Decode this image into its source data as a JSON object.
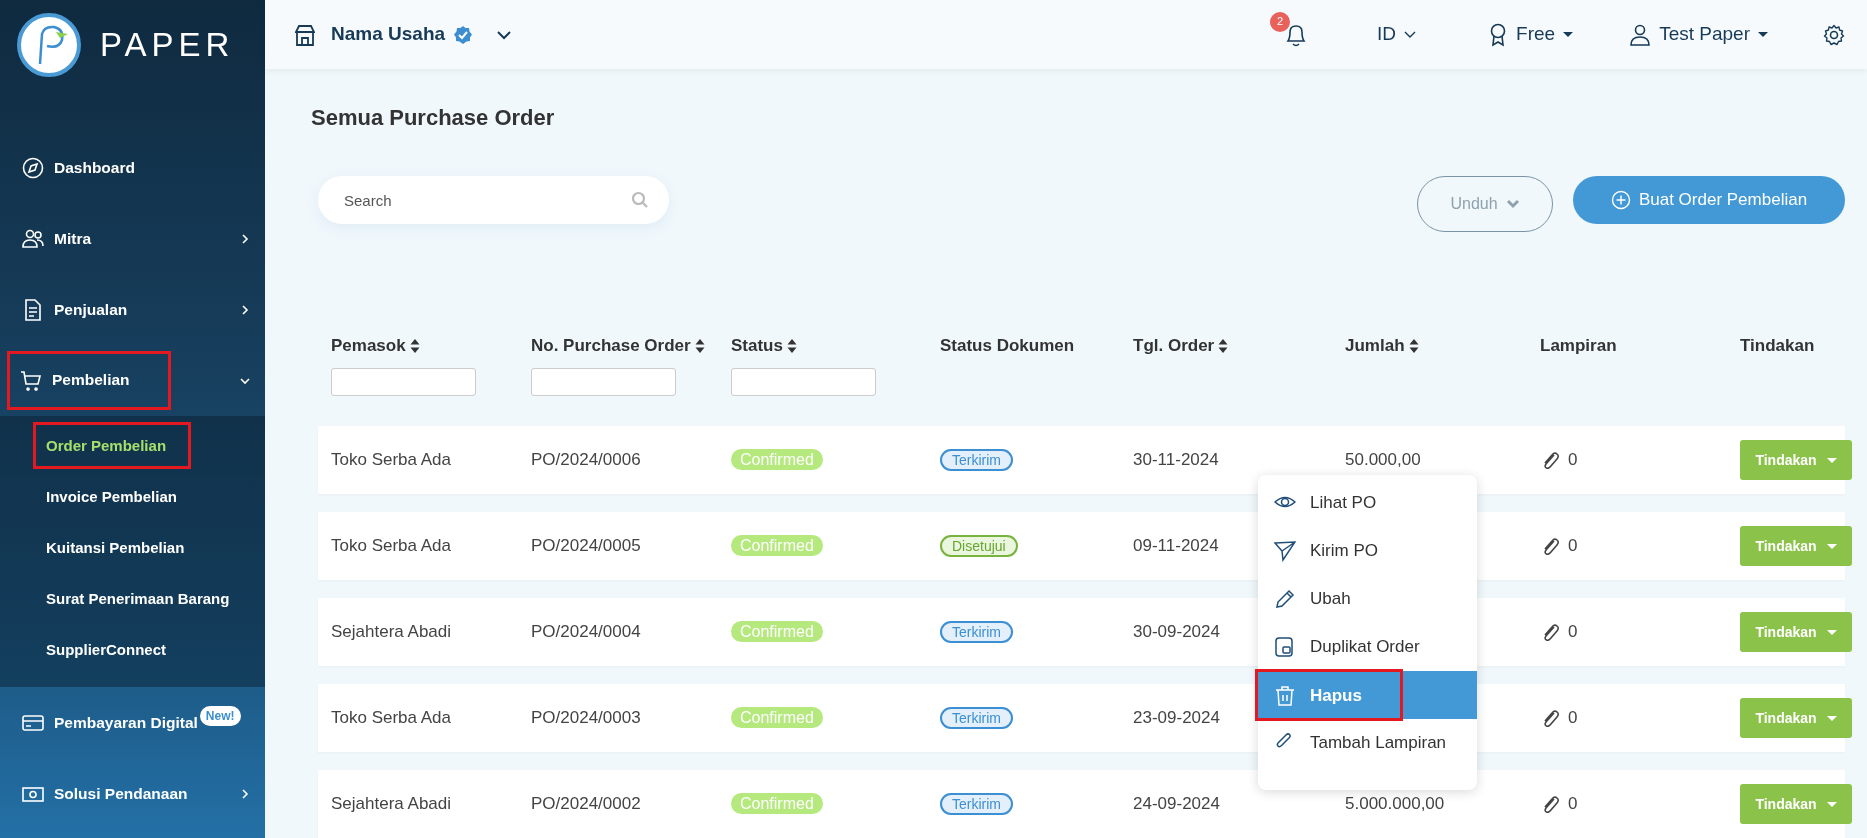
{
  "sidebar": {
    "logo": "PAPER",
    "items": [
      {
        "label": "Dashboard",
        "kind": "link",
        "annotated": false
      },
      {
        "label": "Mitra",
        "kind": "group",
        "expanded": false,
        "annotated": false
      },
      {
        "label": "Penjualan",
        "kind": "group",
        "expanded": false,
        "annotated": false
      },
      {
        "label": "Pembelian",
        "kind": "group",
        "expanded": true,
        "annotated": true,
        "children": [
          {
            "label": "Order Pembelian",
            "selected": true,
            "annotated": true
          },
          {
            "label": "Invoice Pembelian",
            "selected": false,
            "annotated": false
          },
          {
            "label": "Kuitansi Pembelian",
            "selected": false,
            "annotated": false
          },
          {
            "label": "Surat Penerimaan Barang",
            "selected": false,
            "annotated": false
          },
          {
            "label": "SupplierConnect",
            "selected": false,
            "annotated": false
          }
        ]
      },
      {
        "label": "Pembayaran Digital",
        "kind": "link",
        "badge": "New!",
        "annotated": false
      },
      {
        "label": "Solusi Pendanaan",
        "kind": "group",
        "expanded": false,
        "annotated": false
      }
    ]
  },
  "header": {
    "business_name": "Nama Usaha",
    "verified": true,
    "notification_count": "2",
    "language": "ID",
    "plan": "Free",
    "user": "Test Paper"
  },
  "page": {
    "title": "Semua Purchase Order",
    "search": {
      "placeholder": "Search"
    },
    "buttons": [
      {
        "label": "Unduh",
        "kind": "outline"
      },
      {
        "label": "Buat Order Pembelian",
        "kind": "primary"
      }
    ]
  },
  "table": {
    "columns": [
      {
        "label": "Pemasok",
        "sortable": true,
        "filter": true
      },
      {
        "label": "No. Purchase Order",
        "sortable": true,
        "filter": true
      },
      {
        "label": "Status",
        "sortable": true,
        "filter": true
      },
      {
        "label": "Status Dokumen",
        "sortable": false,
        "filter": false
      },
      {
        "label": "Tgl. Order",
        "sortable": true,
        "filter": false
      },
      {
        "label": "Jumlah",
        "sortable": true,
        "filter": false
      },
      {
        "label": "Lampiran",
        "sortable": false,
        "filter": false
      },
      {
        "label": "Tindakan",
        "sortable": false,
        "filter": false
      }
    ],
    "rows": [
      {
        "supplier": "Toko Serba Ada",
        "po_number": "PO/2024/0006",
        "status": "Confirmed",
        "doc_status": {
          "label": "Terkirim",
          "kind": "sent"
        },
        "date": "30-11-2024",
        "amount": "50.000,00",
        "attachments": "0",
        "action": "Tindakan"
      },
      {
        "supplier": "Toko Serba Ada",
        "po_number": "PO/2024/0005",
        "status": "Confirmed",
        "doc_status": {
          "label": "Disetujui",
          "kind": "approved"
        },
        "date": "09-11-2024",
        "attachments": "0",
        "action": "Tindakan"
      },
      {
        "supplier": "Sejahtera Abadi",
        "po_number": "PO/2024/0004",
        "status": "Confirmed",
        "doc_status": {
          "label": "Terkirim",
          "kind": "sent"
        },
        "date": "30-09-2024",
        "attachments": "0",
        "action": "Tindakan"
      },
      {
        "supplier": "Toko Serba Ada",
        "po_number": "PO/2024/0003",
        "status": "Confirmed",
        "doc_status": {
          "label": "Terkirim",
          "kind": "sent"
        },
        "date": "23-09-2024",
        "attachments": "0",
        "action": "Tindakan"
      },
      {
        "supplier": "Sejahtera Abadi",
        "po_number": "PO/2024/0002",
        "status": "Confirmed",
        "doc_status": {
          "label": "Terkirim",
          "kind": "sent"
        },
        "date": "24-09-2024",
        "amount": "5.000.000,00",
        "attachments": "0",
        "action": "Tindakan"
      }
    ]
  },
  "action_menu": {
    "items": [
      {
        "label": "Lihat PO",
        "selected": false,
        "annotated": false
      },
      {
        "label": "Kirim PO",
        "selected": false,
        "annotated": false
      },
      {
        "label": "Ubah",
        "selected": false,
        "annotated": false
      },
      {
        "label": "Duplikat Order",
        "selected": false,
        "annotated": false
      },
      {
        "label": "Hapus",
        "selected": true,
        "annotated": true
      },
      {
        "label": "Tambah Lampiran",
        "selected": false,
        "annotated": false
      }
    ]
  }
}
